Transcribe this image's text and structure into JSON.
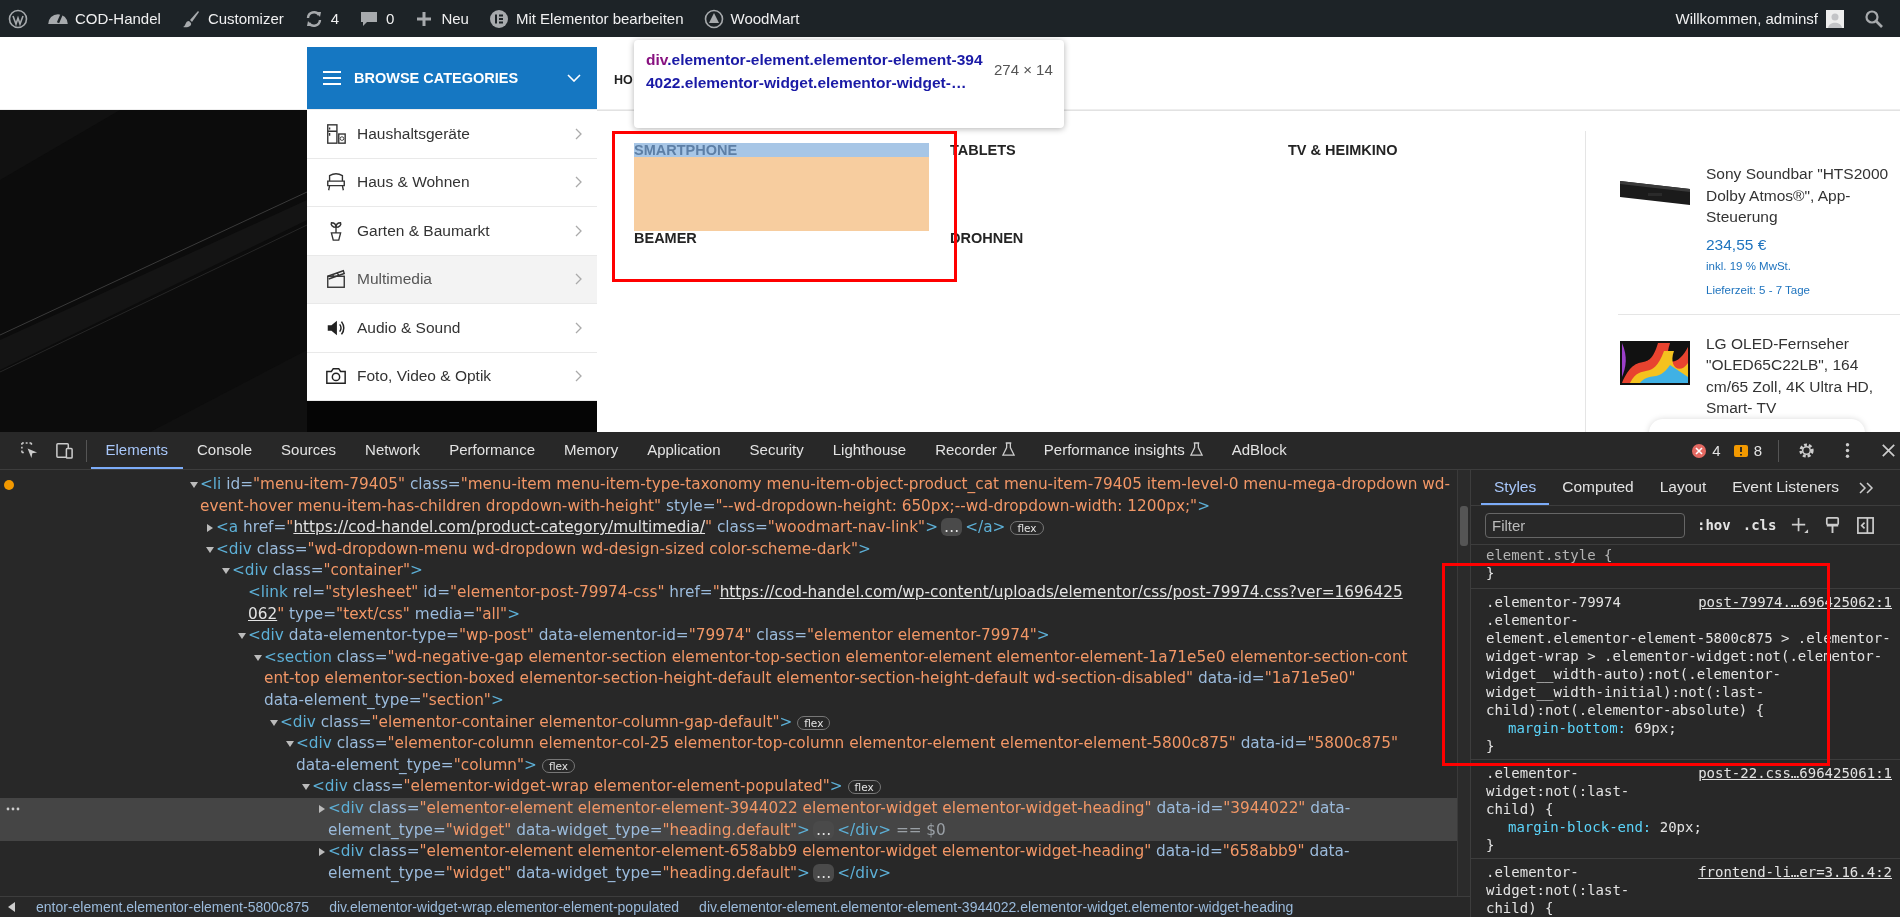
{
  "admin_bar": {
    "items": [
      {
        "kind": "wp"
      },
      {
        "kind": "site",
        "label": "COD-Handel"
      },
      {
        "kind": "customizer",
        "label": "Customizer"
      },
      {
        "kind": "updates",
        "label": "4"
      },
      {
        "kind": "comments",
        "label": "0"
      },
      {
        "kind": "new",
        "label": "Neu"
      },
      {
        "kind": "elementor",
        "label": "Mit Elementor bearbeiten"
      },
      {
        "kind": "woodmart",
        "label": "WoodMart"
      }
    ],
    "greeting": "Willkommen, adminsf"
  },
  "header": {
    "browse_button": "BROWSE CATEGORIES",
    "nav_item": "HO"
  },
  "categories": [
    {
      "kind": "appliance",
      "label": "Haushaltsgeräte",
      "selected": false
    },
    {
      "kind": "armchair",
      "label": "Haus & Wohnen",
      "selected": false
    },
    {
      "kind": "plant",
      "label": "Garten & Baumarkt",
      "selected": false
    },
    {
      "kind": "clapper",
      "label": "Multimedia",
      "selected": true
    },
    {
      "kind": "speaker",
      "label": "Audio & Sound",
      "selected": false
    },
    {
      "kind": "camera",
      "label": "Foto, Video & Optik",
      "selected": false
    }
  ],
  "inspect_tooltip": {
    "tag": "div",
    "selector": ".elementor-element.elementor-element-3944022.elementor-widget.elementor-widget-…",
    "size": "274 × 14"
  },
  "mega_menu": {
    "links": [
      {
        "label": "SMARTPHONE",
        "inspected": true
      },
      {
        "label": "TABLETS",
        "inspected": false
      },
      {
        "label": "TV & HEIMKINO",
        "inspected": false
      },
      {
        "label": "BEAMER",
        "inspected": false
      },
      {
        "label": "DROHNEN",
        "inspected": false
      }
    ],
    "products": [
      {
        "name": "Sony Soundbar \"HTS2000 Dolby Atmos®\", App-Steuerung",
        "price": "234,55 €",
        "tax_note": "inkl. 19 % MwSt.",
        "delivery": "Lieferzeit: 5 - 7 Tage"
      },
      {
        "name": "LG OLED-Fernseher \"OLED65C22LB\", 164 cm/65 Zoll, 4K Ultra HD, Smart- TV"
      }
    ]
  },
  "devtools": {
    "tabs": [
      {
        "label": "Elements",
        "selected": true,
        "experimental": false
      },
      {
        "label": "Console",
        "selected": false,
        "experimental": false
      },
      {
        "label": "Sources",
        "selected": false,
        "experimental": false
      },
      {
        "label": "Network",
        "selected": false,
        "experimental": false
      },
      {
        "label": "Performance",
        "selected": false,
        "experimental": false
      },
      {
        "label": "Memory",
        "selected": false,
        "experimental": false
      },
      {
        "label": "Application",
        "selected": false,
        "experimental": false
      },
      {
        "label": "Security",
        "selected": false,
        "experimental": false
      },
      {
        "label": "Lighthouse",
        "selected": false,
        "experimental": false
      },
      {
        "label": "Recorder",
        "selected": false,
        "experimental": true
      },
      {
        "label": "Performance insights",
        "selected": false,
        "experimental": true
      },
      {
        "label": "AdBlock",
        "selected": false,
        "experimental": false
      }
    ],
    "errors": "4",
    "warnings": "8",
    "dom_tree": [
      {
        "expanded": true,
        "selected": false,
        "issue": true,
        "lines": [
          [
            {
              "kind": "tag",
              "text": "<li"
            },
            {
              "kind": "attr",
              "text": " id="
            },
            {
              "kind": "val",
              "text": "\"menu-item-79405\""
            },
            {
              "kind": "attr",
              "text": " class="
            },
            {
              "kind": "val",
              "text": "\"menu-item menu-item-type-taxonomy menu-item-object-product_cat menu-item-79405 item-level-0 menu-mega-dropdown wd-"
            }
          ],
          [
            {
              "kind": "val",
              "text": "event-hover menu-item-has-children dropdown-with-height\""
            },
            {
              "kind": "attr",
              "text": " style="
            },
            {
              "kind": "val",
              "text": "\"--wd-dropdown-height: 650px;--wd-dropdown-width: 1200px;\""
            },
            {
              "kind": "tag",
              "text": ">"
            }
          ]
        ],
        "children": [
          {
            "expanded": false,
            "selected": false,
            "lines": [
              [
                {
                  "kind": "tag",
                  "text": "<a"
                },
                {
                  "kind": "attr",
                  "text": " href="
                },
                {
                  "kind": "val",
                  "text": "\""
                },
                {
                  "kind": "link",
                  "text": "https://cod-handel.com/product-category/multimedia/"
                },
                {
                  "kind": "val",
                  "text": "\""
                },
                {
                  "kind": "attr",
                  "text": " class="
                },
                {
                  "kind": "val",
                  "text": "\"woodmart-nav-link\""
                },
                {
                  "kind": "tag",
                  "text": ">"
                },
                {
                  "kind": "more",
                  "text": "…"
                },
                {
                  "kind": "tag",
                  "text": "</a>"
                },
                {
                  "kind": "badge",
                  "text": "flex"
                }
              ]
            ]
          },
          {
            "expanded": true,
            "selected": false,
            "lines": [
              [
                {
                  "kind": "tag",
                  "text": "<div"
                },
                {
                  "kind": "attr",
                  "text": " class="
                },
                {
                  "kind": "val",
                  "text": "\"wd-dropdown-menu wd-dropdown wd-design-sized color-scheme-dark\""
                },
                {
                  "kind": "tag",
                  "text": ">"
                }
              ]
            ],
            "children": [
              {
                "expanded": true,
                "selected": false,
                "lines": [
                  [
                    {
                      "kind": "tag",
                      "text": "<div"
                    },
                    {
                      "kind": "attr",
                      "text": " class="
                    },
                    {
                      "kind": "val",
                      "text": "\"container\""
                    },
                    {
                      "kind": "tag",
                      "text": ">"
                    }
                  ]
                ],
                "children": [
                  {
                    "selected": false,
                    "lines": [
                      [
                        {
                          "kind": "tag",
                          "text": "<link"
                        },
                        {
                          "kind": "attr",
                          "text": " rel="
                        },
                        {
                          "kind": "val",
                          "text": "\"stylesheet\""
                        },
                        {
                          "kind": "attr",
                          "text": " id="
                        },
                        {
                          "kind": "val",
                          "text": "\"elementor-post-79974-css\""
                        },
                        {
                          "kind": "attr",
                          "text": " href="
                        },
                        {
                          "kind": "val",
                          "text": "\""
                        },
                        {
                          "kind": "link",
                          "text": "https://cod-handel.com/wp-content/uploads/elementor/css/post-79974.css?ver=1696425"
                        }
                      ],
                      [
                        {
                          "kind": "link",
                          "text": "062"
                        },
                        {
                          "kind": "val",
                          "text": "\""
                        },
                        {
                          "kind": "attr",
                          "text": " type="
                        },
                        {
                          "kind": "val",
                          "text": "\"text/css\""
                        },
                        {
                          "kind": "attr",
                          "text": " media="
                        },
                        {
                          "kind": "val",
                          "text": "\"all\""
                        },
                        {
                          "kind": "tag",
                          "text": ">"
                        }
                      ]
                    ]
                  },
                  {
                    "expanded": true,
                    "selected": false,
                    "lines": [
                      [
                        {
                          "kind": "tag",
                          "text": "<div"
                        },
                        {
                          "kind": "attr",
                          "text": " data-elementor-type="
                        },
                        {
                          "kind": "val",
                          "text": "\"wp-post\""
                        },
                        {
                          "kind": "attr",
                          "text": " data-elementor-id="
                        },
                        {
                          "kind": "val",
                          "text": "\"79974\""
                        },
                        {
                          "kind": "attr",
                          "text": " class="
                        },
                        {
                          "kind": "val",
                          "text": "\"elementor elementor-79974\""
                        },
                        {
                          "kind": "tag",
                          "text": ">"
                        }
                      ]
                    ],
                    "children": [
                      {
                        "expanded": true,
                        "selected": false,
                        "lines": [
                          [
                            {
                              "kind": "tag",
                              "text": "<section"
                            },
                            {
                              "kind": "attr",
                              "text": " class="
                            },
                            {
                              "kind": "val",
                              "text": "\"wd-negative-gap elementor-section elementor-top-section elementor-element elementor-element-1a71e5e0 elementor-section-cont"
                            }
                          ],
                          [
                            {
                              "kind": "val",
                              "text": "ent-top elementor-section-boxed elementor-section-height-default elementor-section-height-default wd-section-disabled\""
                            },
                            {
                              "kind": "attr",
                              "text": " data-id="
                            },
                            {
                              "kind": "val",
                              "text": "\"1a71e5e0\""
                            }
                          ],
                          [
                            {
                              "kind": "attr",
                              "text": "data-element_type="
                            },
                            {
                              "kind": "val",
                              "text": "\"section\""
                            },
                            {
                              "kind": "tag",
                              "text": ">"
                            }
                          ]
                        ],
                        "children": [
                          {
                            "expanded": true,
                            "selected": false,
                            "lines": [
                              [
                                {
                                  "kind": "tag",
                                  "text": "<div"
                                },
                                {
                                  "kind": "attr",
                                  "text": " class="
                                },
                                {
                                  "kind": "val",
                                  "text": "\"elementor-container elementor-column-gap-default\""
                                },
                                {
                                  "kind": "tag",
                                  "text": ">"
                                },
                                {
                                  "kind": "badge",
                                  "text": "flex"
                                }
                              ]
                            ],
                            "children": [
                              {
                                "expanded": true,
                                "selected": false,
                                "lines": [
                                  [
                                    {
                                      "kind": "tag",
                                      "text": "<div"
                                    },
                                    {
                                      "kind": "attr",
                                      "text": " class="
                                    },
                                    {
                                      "kind": "val",
                                      "text": "\"elementor-column elementor-col-25 elementor-top-column elementor-element elementor-element-5800c875\""
                                    },
                                    {
                                      "kind": "attr",
                                      "text": " data-id="
                                    },
                                    {
                                      "kind": "val",
                                      "text": "\"5800c875\""
                                    }
                                  ],
                                  [
                                    {
                                      "kind": "attr",
                                      "text": "data-element_type="
                                    },
                                    {
                                      "kind": "val",
                                      "text": "\"column\""
                                    },
                                    {
                                      "kind": "tag",
                                      "text": ">"
                                    },
                                    {
                                      "kind": "badge",
                                      "text": "flex"
                                    }
                                  ]
                                ],
                                "children": [
                                  {
                                    "expanded": true,
                                    "selected": false,
                                    "lines": [
                                      [
                                        {
                                          "kind": "tag",
                                          "text": "<div"
                                        },
                                        {
                                          "kind": "attr",
                                          "text": " class="
                                        },
                                        {
                                          "kind": "val",
                                          "text": "\"elementor-widget-wrap elementor-element-populated\""
                                        },
                                        {
                                          "kind": "tag",
                                          "text": ">"
                                        },
                                        {
                                          "kind": "badge",
                                          "text": "flex"
                                        }
                                      ]
                                    ],
                                    "children": [
                                      {
                                        "expanded": false,
                                        "selected": true,
                                        "lines": [
                                          [
                                            {
                                              "kind": "tag",
                                              "text": "<div"
                                            },
                                            {
                                              "kind": "attr",
                                              "text": " class="
                                            },
                                            {
                                              "kind": "val",
                                              "text": "\"elementor-element elementor-element-3944022 elementor-widget elementor-widget-heading\""
                                            },
                                            {
                                              "kind": "attr",
                                              "text": " data-id="
                                            },
                                            {
                                              "kind": "val",
                                              "text": "\"3944022\""
                                            },
                                            {
                                              "kind": "attr",
                                              "text": " data-"
                                            }
                                          ],
                                          [
                                            {
                                              "kind": "attr",
                                              "text": "element_type="
                                            },
                                            {
                                              "kind": "val",
                                              "text": "\"widget\""
                                            },
                                            {
                                              "kind": "attr",
                                              "text": " data-widget_type="
                                            },
                                            {
                                              "kind": "val",
                                              "text": "\"heading.default\""
                                            },
                                            {
                                              "kind": "tag",
                                              "text": ">"
                                            },
                                            {
                                              "kind": "more",
                                              "text": "…"
                                            },
                                            {
                                              "kind": "tag",
                                              "text": "</div>"
                                            },
                                            {
                                              "kind": "note",
                                              "text": " == $0"
                                            }
                                          ]
                                        ]
                                      },
                                      {
                                        "expanded": false,
                                        "selected": false,
                                        "lines": [
                                          [
                                            {
                                              "kind": "tag",
                                              "text": "<div"
                                            },
                                            {
                                              "kind": "attr",
                                              "text": " class="
                                            },
                                            {
                                              "kind": "val",
                                              "text": "\"elementor-element elementor-element-658abb9 elementor-widget elementor-widget-heading\""
                                            },
                                            {
                                              "kind": "attr",
                                              "text": " data-id="
                                            },
                                            {
                                              "kind": "val",
                                              "text": "\"658abb9\""
                                            },
                                            {
                                              "kind": "attr",
                                              "text": " data-"
                                            }
                                          ],
                                          [
                                            {
                                              "kind": "attr",
                                              "text": "element_type="
                                            },
                                            {
                                              "kind": "val",
                                              "text": "\"widget\""
                                            },
                                            {
                                              "kind": "attr",
                                              "text": " data-widget_type="
                                            },
                                            {
                                              "kind": "val",
                                              "text": "\"heading.default\""
                                            },
                                            {
                                              "kind": "tag",
                                              "text": ">"
                                            },
                                            {
                                              "kind": "more",
                                              "text": "…"
                                            },
                                            {
                                              "kind": "tag",
                                              "text": "</div>"
                                            }
                                          ]
                                        ]
                                      }
                                    ]
                                  }
                                ]
                              }
                            ]
                          }
                        ]
                      }
                    ]
                  }
                ]
              }
            ]
          }
        ]
      }
    ],
    "breadcrumbs": [
      "entor-element.elementor-element-5800c875",
      "div.elementor-widget-wrap.elementor-element-populated",
      "div.elementor-element.elementor-element-3944022.elementor-widget.elementor-widget-heading"
    ],
    "sidebar_tabs": [
      {
        "label": "Styles",
        "selected": true
      },
      {
        "label": "Computed",
        "selected": false
      },
      {
        "label": "Layout",
        "selected": false
      },
      {
        "label": "Event Listeners",
        "selected": false
      }
    ],
    "filter_placeholder": "Filter",
    "toggles": [
      ":hov",
      ".cls"
    ],
    "rules": [
      {
        "kind": "inline",
        "selector_lines": [
          "element.style {"
        ],
        "close": "}"
      },
      {
        "kind": "rule",
        "source": "post-79974.…696425062:1",
        "selector_lines": [
          ".elementor-79974",
          ".elementor-",
          "element.elementor-element-5800c875 > .elementor-",
          "widget-wrap > .elementor-widget:not(.elementor-",
          "widget__width-auto):not(.elementor-",
          "widget__width-initial):not(:last-",
          "child):not(.elementor-absolute) {"
        ],
        "declarations": [
          {
            "property": "margin-bottom:",
            "value": "69px;"
          }
        ],
        "close": "}"
      },
      {
        "kind": "rule",
        "source": "post-22.css…696425061:1",
        "selector_lines": [
          ".elementor-",
          "widget:not(:last-",
          "child) {"
        ],
        "declarations": [
          {
            "property": "margin-block-end:",
            "value": "20px;"
          }
        ],
        "close": "}"
      },
      {
        "kind": "rule",
        "source": "frontend-li…er=3.16.4:2",
        "selector_lines": [
          ".elementor-",
          "widget:not(:last-",
          "child) {"
        ]
      }
    ]
  }
}
